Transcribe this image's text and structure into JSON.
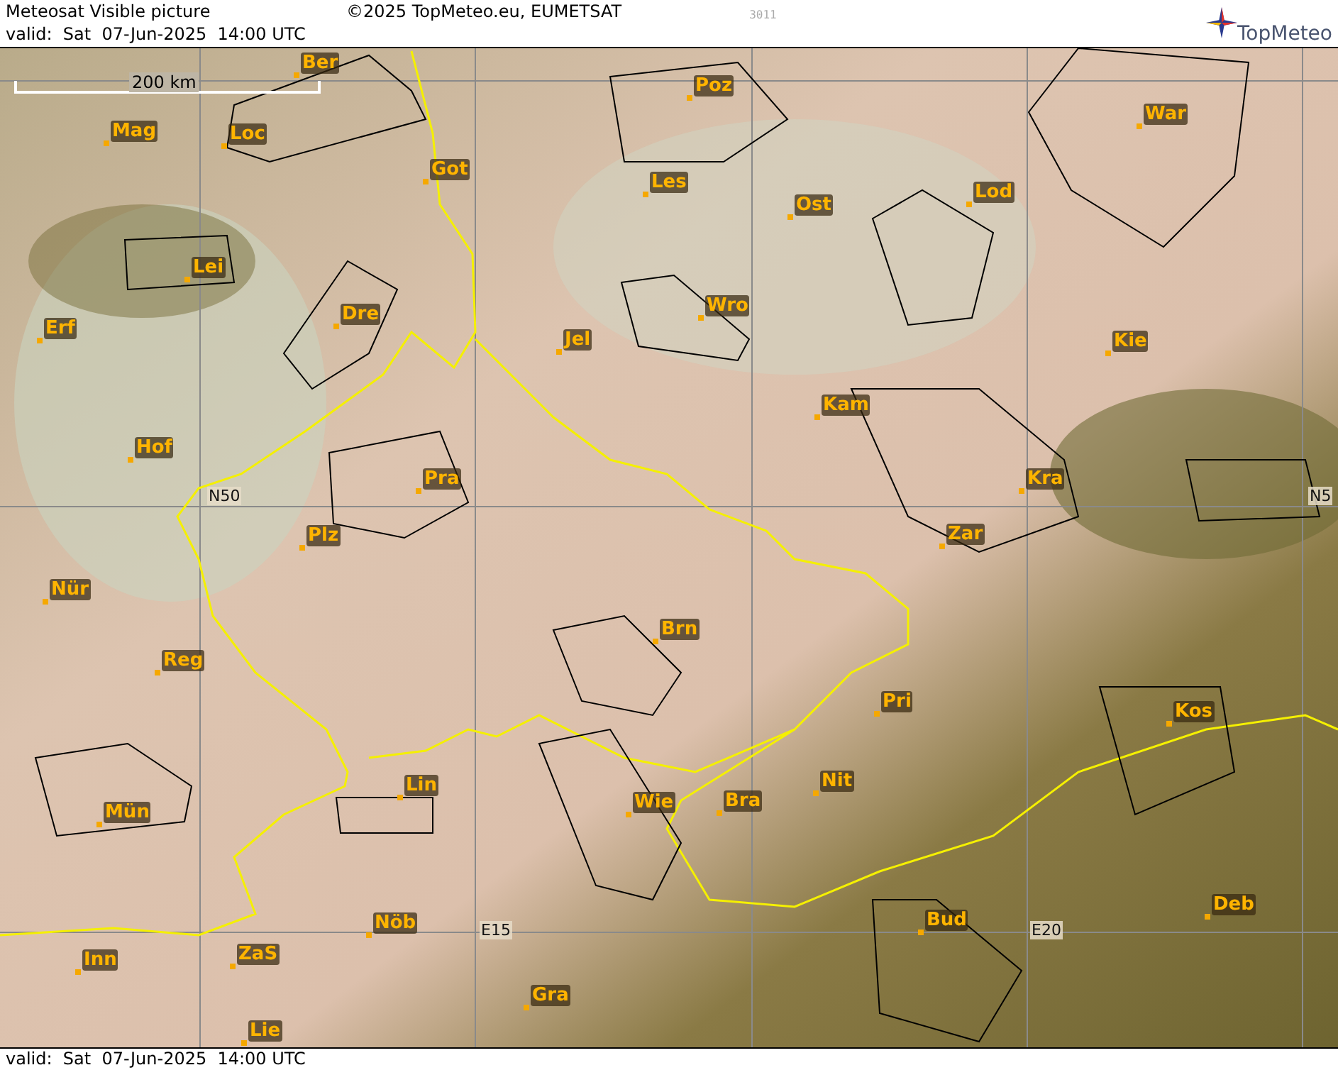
{
  "header": {
    "title": "Meteosat Visible picture",
    "copyright": "©2025 TopMeteo.eu, EUMETSAT",
    "code": "3011",
    "valid": "valid:  Sat  07-Jun-2025  14:00 UTC",
    "logo": "TopMeteo"
  },
  "map": {
    "scale": "200 km",
    "places": [
      {
        "name": "Ber"
      },
      {
        "name": "Mag"
      },
      {
        "name": "Loc"
      },
      {
        "name": "Got"
      },
      {
        "name": "Les"
      },
      {
        "name": "Poz"
      },
      {
        "name": "Ost"
      },
      {
        "name": "Lod"
      },
      {
        "name": "War"
      },
      {
        "name": "Lei"
      },
      {
        "name": "Dre"
      },
      {
        "name": "Wro"
      },
      {
        "name": "Erf"
      },
      {
        "name": "Jel"
      },
      {
        "name": "Kie"
      },
      {
        "name": "Kam"
      },
      {
        "name": "Hof"
      },
      {
        "name": "Pra"
      },
      {
        "name": "Kra"
      },
      {
        "name": "Plz"
      },
      {
        "name": "Zar"
      },
      {
        "name": "Nür"
      },
      {
        "name": "Brn"
      },
      {
        "name": "Reg"
      },
      {
        "name": "Pri"
      },
      {
        "name": "Kos"
      },
      {
        "name": "Nit"
      },
      {
        "name": "Lin"
      },
      {
        "name": "Wie"
      },
      {
        "name": "Bra"
      },
      {
        "name": "Mün"
      },
      {
        "name": "Nöb"
      },
      {
        "name": "Bud"
      },
      {
        "name": "Deb"
      },
      {
        "name": "Inn"
      },
      {
        "name": "ZaS"
      },
      {
        "name": "Gra"
      },
      {
        "name": "Lie"
      }
    ],
    "grid_labels": [
      {
        "text": "N50"
      },
      {
        "text": "N5"
      },
      {
        "text": "E15"
      },
      {
        "text": "E20"
      }
    ]
  },
  "footer": {
    "valid": "valid:  Sat  07-Jun-2025  14:00 UTC"
  }
}
